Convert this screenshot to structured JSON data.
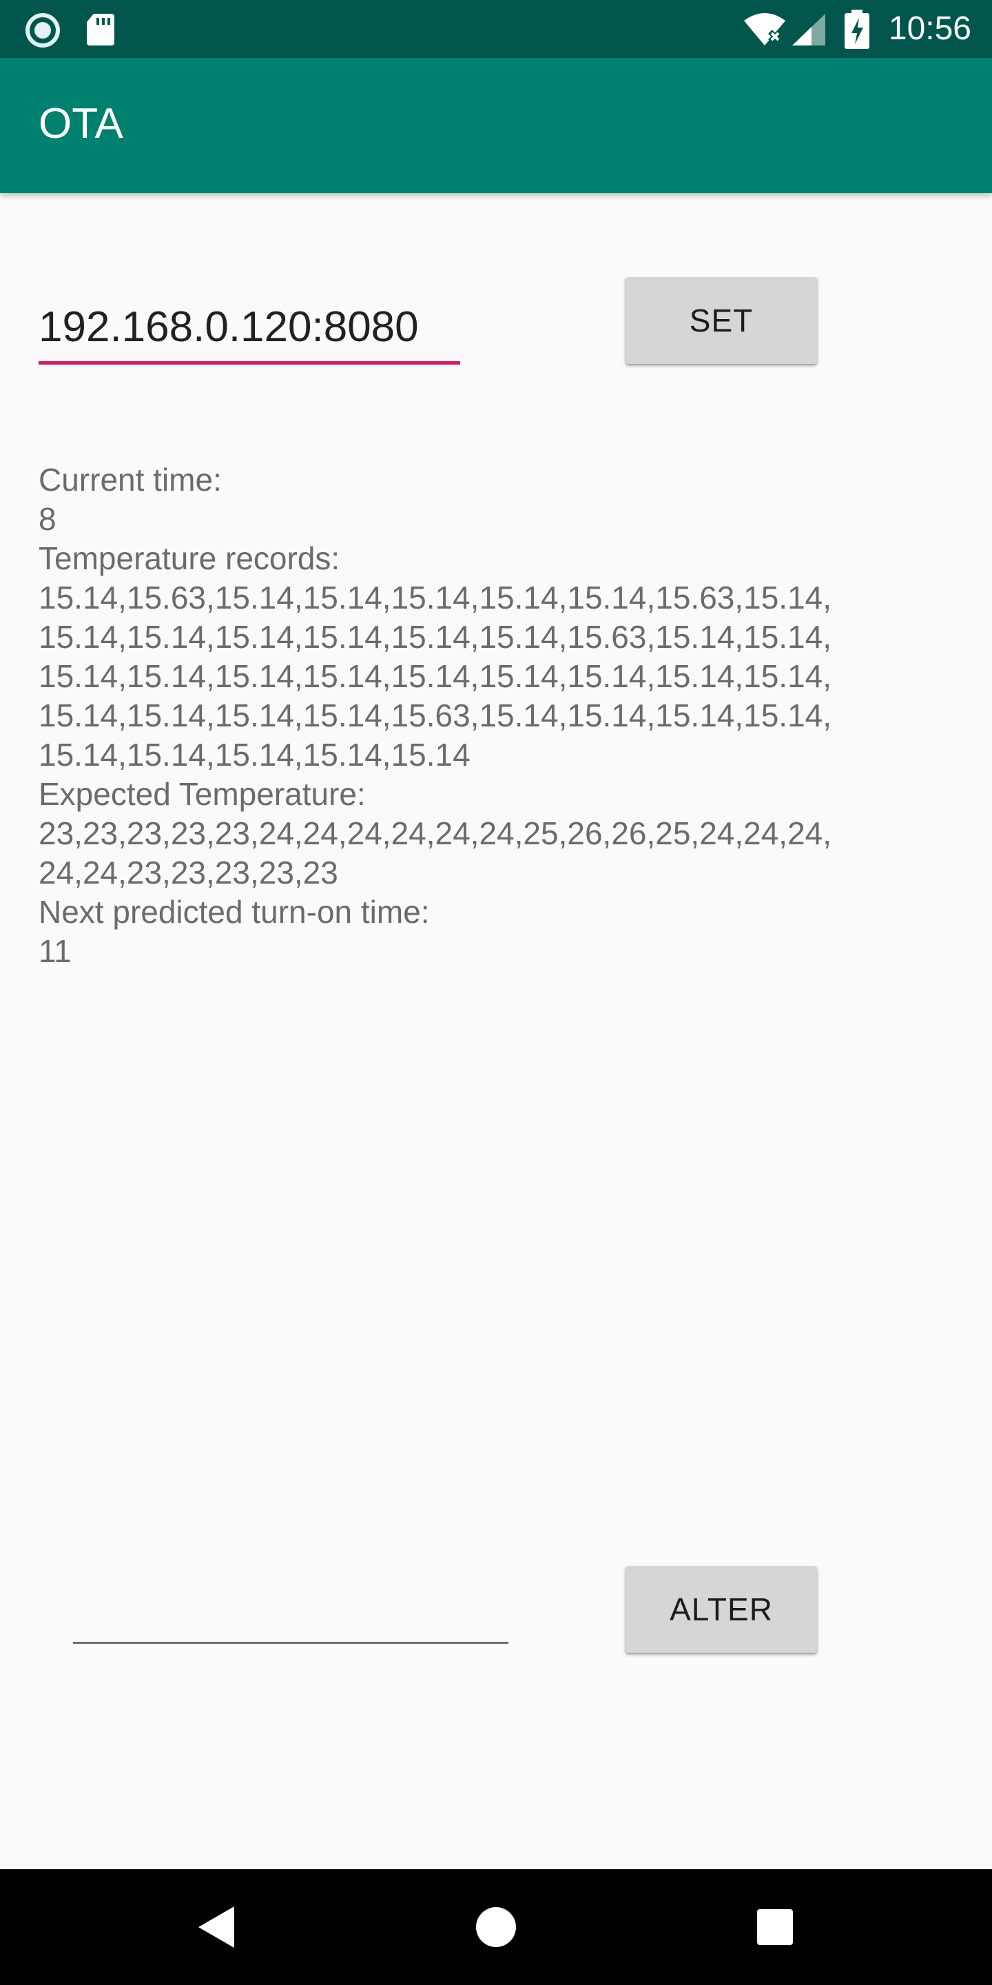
{
  "status_bar": {
    "time": "10:56",
    "icons": [
      "circle-notification-icon",
      "sd-card-icon",
      "wifi-off-icon",
      "cell-signal-icon",
      "battery-charging-icon"
    ]
  },
  "app_bar": {
    "title": "OTA"
  },
  "server": {
    "url_value": "192.168.0.120:8080",
    "set_label": "SET"
  },
  "info": {
    "current_time_label": "Current time:",
    "current_time_value": "8",
    "temperature_records_label": "Temperature records:",
    "temperature_records_value": "15.14,15.63,15.14,15.14,15.14,15.14,15.14,15.63,15.14,15.14,15.14,15.14,15.14,15.14,15.14,15.63,15.14,15.14,15.14,15.14,15.14,15.14,15.14,15.14,15.14,15.14,15.14,15.14,15.14,15.14,15.14,15.63,15.14,15.14,15.14,15.14,15.14,15.14,15.14,15.14,15.14",
    "expected_temperature_label": "Expected Temperature:",
    "expected_temperature_value": "23,23,23,23,23,24,24,24,24,24,24,25,26,26,25,24,24,24,24,24,23,23,23,23,23",
    "next_turn_on_label": "Next predicted turn-on time:",
    "next_turn_on_value": "11"
  },
  "alter": {
    "input_value": "",
    "alter_label": "ALTER"
  },
  "colors": {
    "status_bar": "#00564d",
    "app_bar": "#00806f",
    "accent": "#d81b60",
    "button": "#d6d6d6",
    "background": "#fafafa"
  },
  "nav_bar": {
    "icons": [
      "back-icon",
      "home-icon",
      "recents-icon"
    ]
  }
}
